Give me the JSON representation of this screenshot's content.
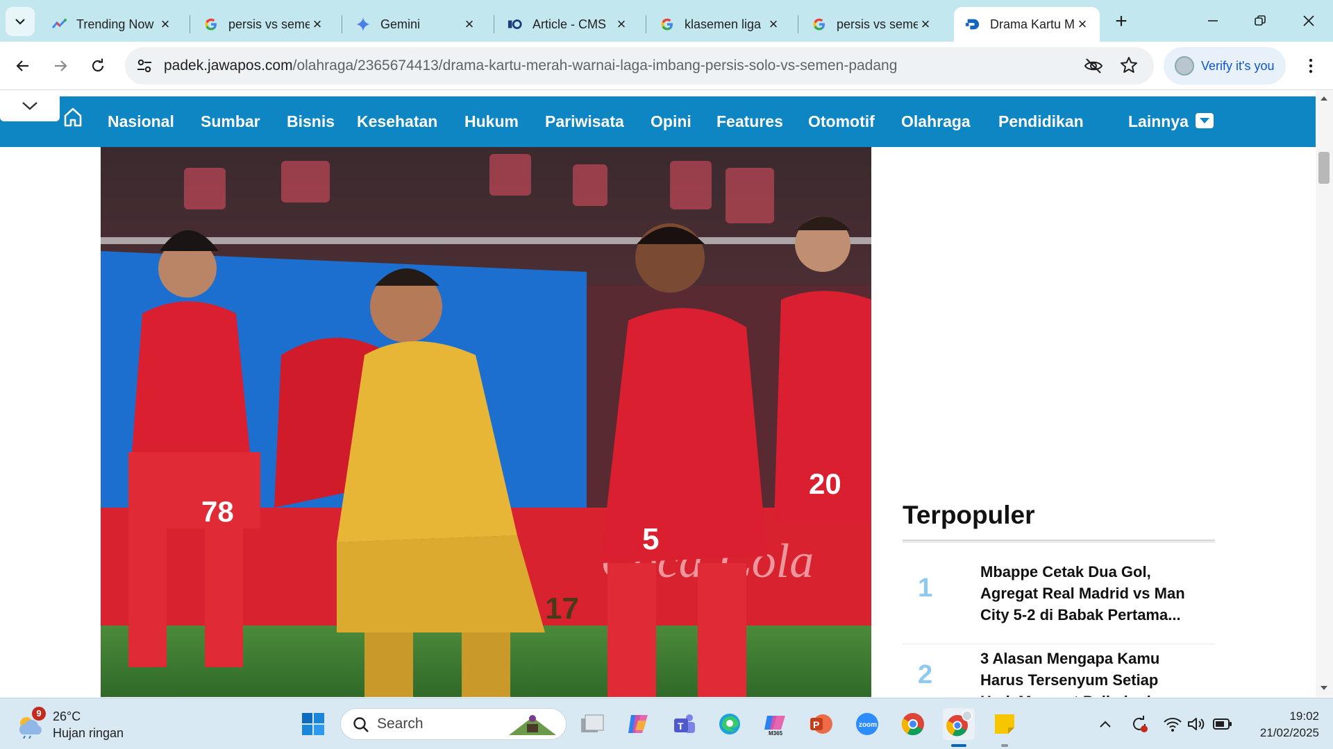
{
  "browser": {
    "tabs": [
      {
        "title": "Trending Now",
        "favicon": "trends-icon"
      },
      {
        "title": "persis vs seme",
        "favicon": "google-icon"
      },
      {
        "title": "Gemini",
        "favicon": "gemini-icon"
      },
      {
        "title": "Article - CMS",
        "favicon": "cms-icon"
      },
      {
        "title": "klasemen liga",
        "favicon": "google-icon"
      },
      {
        "title": "persis vs seme",
        "favicon": "google-icon"
      },
      {
        "title": "Drama Kartu M",
        "favicon": "jawapos-icon",
        "active": true
      }
    ],
    "url_host": "padek.jawapos.com",
    "url_path": "/olahraga/2365674413/drama-kartu-merah-warnai-laga-imbang-persis-solo-vs-semen-padang",
    "verify_label": "Verify it's you"
  },
  "site_nav": {
    "items": [
      "Nasional",
      "Sumbar",
      "Bisnis",
      "Kesehatan",
      "Hukum",
      "Pariwisata",
      "Opini",
      "Features",
      "Otomotif",
      "Olahraga",
      "Pendidikan",
      "Lainnya"
    ],
    "color": "#0f86c4"
  },
  "article": {
    "photo": {
      "players": [
        {
          "kit": "red",
          "number": "78"
        },
        {
          "kit": "yellow",
          "number": "17"
        },
        {
          "kit": "red",
          "number": "5"
        },
        {
          "kit": "red",
          "number": "20"
        }
      ],
      "banner_text": "Coca-Cola"
    }
  },
  "sidebar": {
    "heading": "Terpopuler",
    "items": [
      {
        "rank": "1",
        "title_lines": [
          "Mbappe Cetak Dua Gol,",
          "Agregat Real Madrid vs Man",
          "City 5-2 di Babak Pertama..."
        ]
      },
      {
        "rank": "2",
        "title_lines": [
          "3 Alasan Mengapa Kamu",
          "Harus Tersenyum Setiap",
          "Hari, Menurut Psikologi"
        ]
      }
    ]
  },
  "taskbar": {
    "weather_badge": "9",
    "temperature": "26°C",
    "condition": "Hujan ringan",
    "search_placeholder": "Search",
    "time": "19:02",
    "date": "21/02/2025",
    "apps": [
      "windows-start-icon",
      "file-manager-icon",
      "copilot-icon",
      "teams-icon",
      "edge-icon",
      "m365-icon",
      "powerpoint-icon",
      "zoom-icon",
      "chrome-icon",
      "chrome-profile-icon",
      "sticky-notes-icon"
    ]
  }
}
